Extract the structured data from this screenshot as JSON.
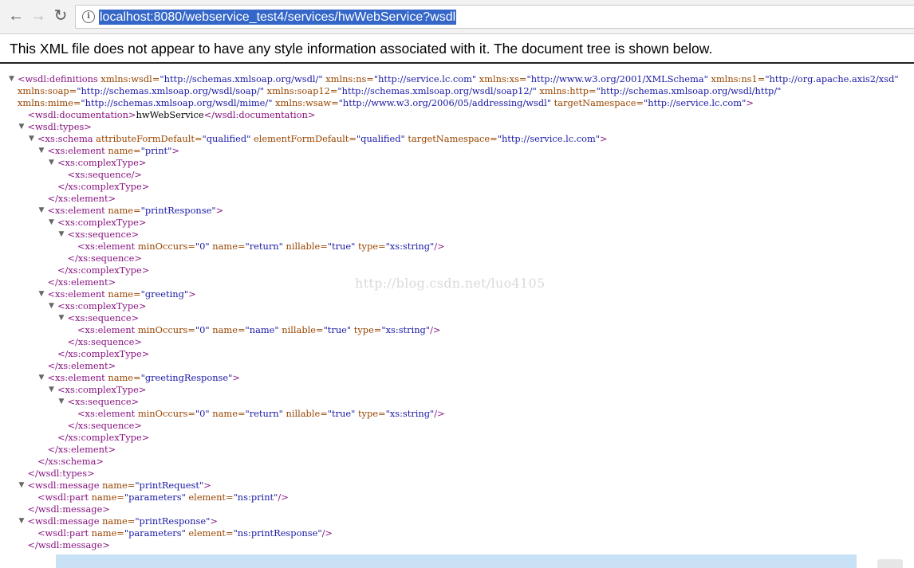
{
  "browser": {
    "back_glyph": "←",
    "forward_glyph": "→",
    "reload_glyph": "↻",
    "info_glyph": "i",
    "url": "localhost:8080/webservice_test4/services/hwWebService?wsdl"
  },
  "notice": "This XML file does not appear to have any style information associated with it. The document tree is shown below.",
  "watermark": "http://blog.csdn.net/luo4105",
  "tree": {
    "expander_glyph": "▼",
    "lines": [
      {
        "indent": 0,
        "toggle": true,
        "parts": [
          {
            "t": "tag",
            "v": "<wsdl:definitions "
          },
          {
            "t": "an",
            "v": "xmlns:wsdl="
          },
          {
            "t": "av",
            "v": "\"http://schemas.xmlsoap.org/wsdl/\""
          },
          {
            "t": "an",
            "v": " xmlns:ns="
          },
          {
            "t": "av",
            "v": "\"http://service.lc.com\""
          },
          {
            "t": "an",
            "v": " xmlns:xs="
          },
          {
            "t": "av",
            "v": "\"http://www.w3.org/2001/XMLSchema\""
          },
          {
            "t": "an",
            "v": " xmlns:ns1="
          },
          {
            "t": "av",
            "v": "\"http://org.apache.axis2/xsd\""
          }
        ]
      },
      {
        "indent": 0,
        "toggle": false,
        "parts": [
          {
            "t": "an",
            "v": "xmlns:soap="
          },
          {
            "t": "av",
            "v": "\"http://schemas.xmlsoap.org/wsdl/soap/\""
          },
          {
            "t": "an",
            "v": " xmlns:soap12="
          },
          {
            "t": "av",
            "v": "\"http://schemas.xmlsoap.org/wsdl/soap12/\""
          },
          {
            "t": "an",
            "v": " xmlns:http="
          },
          {
            "t": "av",
            "v": "\"http://schemas.xmlsoap.org/wsdl/http/\""
          }
        ]
      },
      {
        "indent": 0,
        "toggle": false,
        "parts": [
          {
            "t": "an",
            "v": "xmlns:mime="
          },
          {
            "t": "av",
            "v": "\"http://schemas.xmlsoap.org/wsdl/mime/\""
          },
          {
            "t": "an",
            "v": " xmlns:wsaw="
          },
          {
            "t": "av",
            "v": "\"http://www.w3.org/2006/05/addressing/wsdl\""
          },
          {
            "t": "an",
            "v": " targetNamespace="
          },
          {
            "t": "av",
            "v": "\"http://service.lc.com\""
          },
          {
            "t": "tag",
            "v": ">"
          }
        ]
      },
      {
        "indent": 1,
        "toggle": false,
        "parts": [
          {
            "t": "tag",
            "v": "<wsdl:documentation>"
          },
          {
            "t": "tx",
            "v": "hwWebService"
          },
          {
            "t": "tag",
            "v": "</wsdl:documentation>"
          }
        ]
      },
      {
        "indent": 1,
        "toggle": true,
        "parts": [
          {
            "t": "tag",
            "v": "<wsdl:types>"
          }
        ]
      },
      {
        "indent": 2,
        "toggle": true,
        "parts": [
          {
            "t": "tag",
            "v": "<xs:schema "
          },
          {
            "t": "an",
            "v": "attributeFormDefault="
          },
          {
            "t": "av",
            "v": "\"qualified\""
          },
          {
            "t": "an",
            "v": " elementFormDefault="
          },
          {
            "t": "av",
            "v": "\"qualified\""
          },
          {
            "t": "an",
            "v": " targetNamespace="
          },
          {
            "t": "av",
            "v": "\"http://service.lc.com\""
          },
          {
            "t": "tag",
            "v": ">"
          }
        ]
      },
      {
        "indent": 3,
        "toggle": true,
        "parts": [
          {
            "t": "tag",
            "v": "<xs:element "
          },
          {
            "t": "an",
            "v": "name="
          },
          {
            "t": "av",
            "v": "\"print\""
          },
          {
            "t": "tag",
            "v": ">"
          }
        ]
      },
      {
        "indent": 4,
        "toggle": true,
        "parts": [
          {
            "t": "tag",
            "v": "<xs:complexType>"
          }
        ]
      },
      {
        "indent": 5,
        "toggle": false,
        "parts": [
          {
            "t": "tag",
            "v": "<xs:sequence/>"
          }
        ]
      },
      {
        "indent": 4,
        "toggle": false,
        "parts": [
          {
            "t": "tag",
            "v": "</xs:complexType>"
          }
        ]
      },
      {
        "indent": 3,
        "toggle": false,
        "parts": [
          {
            "t": "tag",
            "v": "</xs:element>"
          }
        ]
      },
      {
        "indent": 3,
        "toggle": true,
        "parts": [
          {
            "t": "tag",
            "v": "<xs:element "
          },
          {
            "t": "an",
            "v": "name="
          },
          {
            "t": "av",
            "v": "\"printResponse\""
          },
          {
            "t": "tag",
            "v": ">"
          }
        ]
      },
      {
        "indent": 4,
        "toggle": true,
        "parts": [
          {
            "t": "tag",
            "v": "<xs:complexType>"
          }
        ]
      },
      {
        "indent": 5,
        "toggle": true,
        "parts": [
          {
            "t": "tag",
            "v": "<xs:sequence>"
          }
        ]
      },
      {
        "indent": 6,
        "toggle": false,
        "parts": [
          {
            "t": "tag",
            "v": "<xs:element "
          },
          {
            "t": "an",
            "v": "minOccurs="
          },
          {
            "t": "av",
            "v": "\"0\""
          },
          {
            "t": "an",
            "v": " name="
          },
          {
            "t": "av",
            "v": "\"return\""
          },
          {
            "t": "an",
            "v": " nillable="
          },
          {
            "t": "av",
            "v": "\"true\""
          },
          {
            "t": "an",
            "v": " type="
          },
          {
            "t": "av",
            "v": "\"xs:string\""
          },
          {
            "t": "tag",
            "v": "/>"
          }
        ]
      },
      {
        "indent": 5,
        "toggle": false,
        "parts": [
          {
            "t": "tag",
            "v": "</xs:sequence>"
          }
        ]
      },
      {
        "indent": 4,
        "toggle": false,
        "parts": [
          {
            "t": "tag",
            "v": "</xs:complexType>"
          }
        ]
      },
      {
        "indent": 3,
        "toggle": false,
        "parts": [
          {
            "t": "tag",
            "v": "</xs:element>"
          }
        ]
      },
      {
        "indent": 3,
        "toggle": true,
        "parts": [
          {
            "t": "tag",
            "v": "<xs:element "
          },
          {
            "t": "an",
            "v": "name="
          },
          {
            "t": "av",
            "v": "\"greeting\""
          },
          {
            "t": "tag",
            "v": ">"
          }
        ]
      },
      {
        "indent": 4,
        "toggle": true,
        "parts": [
          {
            "t": "tag",
            "v": "<xs:complexType>"
          }
        ]
      },
      {
        "indent": 5,
        "toggle": true,
        "parts": [
          {
            "t": "tag",
            "v": "<xs:sequence>"
          }
        ]
      },
      {
        "indent": 6,
        "toggle": false,
        "parts": [
          {
            "t": "tag",
            "v": "<xs:element "
          },
          {
            "t": "an",
            "v": "minOccurs="
          },
          {
            "t": "av",
            "v": "\"0\""
          },
          {
            "t": "an",
            "v": " name="
          },
          {
            "t": "av",
            "v": "\"name\""
          },
          {
            "t": "an",
            "v": " nillable="
          },
          {
            "t": "av",
            "v": "\"true\""
          },
          {
            "t": "an",
            "v": " type="
          },
          {
            "t": "av",
            "v": "\"xs:string\""
          },
          {
            "t": "tag",
            "v": "/>"
          }
        ]
      },
      {
        "indent": 5,
        "toggle": false,
        "parts": [
          {
            "t": "tag",
            "v": "</xs:sequence>"
          }
        ]
      },
      {
        "indent": 4,
        "toggle": false,
        "parts": [
          {
            "t": "tag",
            "v": "</xs:complexType>"
          }
        ]
      },
      {
        "indent": 3,
        "toggle": false,
        "parts": [
          {
            "t": "tag",
            "v": "</xs:element>"
          }
        ]
      },
      {
        "indent": 3,
        "toggle": true,
        "parts": [
          {
            "t": "tag",
            "v": "<xs:element "
          },
          {
            "t": "an",
            "v": "name="
          },
          {
            "t": "av",
            "v": "\"greetingResponse\""
          },
          {
            "t": "tag",
            "v": ">"
          }
        ]
      },
      {
        "indent": 4,
        "toggle": true,
        "parts": [
          {
            "t": "tag",
            "v": "<xs:complexType>"
          }
        ]
      },
      {
        "indent": 5,
        "toggle": true,
        "parts": [
          {
            "t": "tag",
            "v": "<xs:sequence>"
          }
        ]
      },
      {
        "indent": 6,
        "toggle": false,
        "parts": [
          {
            "t": "tag",
            "v": "<xs:element "
          },
          {
            "t": "an",
            "v": "minOccurs="
          },
          {
            "t": "av",
            "v": "\"0\""
          },
          {
            "t": "an",
            "v": " name="
          },
          {
            "t": "av",
            "v": "\"return\""
          },
          {
            "t": "an",
            "v": " nillable="
          },
          {
            "t": "av",
            "v": "\"true\""
          },
          {
            "t": "an",
            "v": " type="
          },
          {
            "t": "av",
            "v": "\"xs:string\""
          },
          {
            "t": "tag",
            "v": "/>"
          }
        ]
      },
      {
        "indent": 5,
        "toggle": false,
        "parts": [
          {
            "t": "tag",
            "v": "</xs:sequence>"
          }
        ]
      },
      {
        "indent": 4,
        "toggle": false,
        "parts": [
          {
            "t": "tag",
            "v": "</xs:complexType>"
          }
        ]
      },
      {
        "indent": 3,
        "toggle": false,
        "parts": [
          {
            "t": "tag",
            "v": "</xs:element>"
          }
        ]
      },
      {
        "indent": 2,
        "toggle": false,
        "parts": [
          {
            "t": "tag",
            "v": "</xs:schema>"
          }
        ]
      },
      {
        "indent": 1,
        "toggle": false,
        "parts": [
          {
            "t": "tag",
            "v": "</wsdl:types>"
          }
        ]
      },
      {
        "indent": 1,
        "toggle": true,
        "parts": [
          {
            "t": "tag",
            "v": "<wsdl:message "
          },
          {
            "t": "an",
            "v": "name="
          },
          {
            "t": "av",
            "v": "\"printRequest\""
          },
          {
            "t": "tag",
            "v": ">"
          }
        ]
      },
      {
        "indent": 2,
        "toggle": false,
        "parts": [
          {
            "t": "tag",
            "v": "<wsdl:part "
          },
          {
            "t": "an",
            "v": "name="
          },
          {
            "t": "av",
            "v": "\"parameters\""
          },
          {
            "t": "an",
            "v": " element="
          },
          {
            "t": "av",
            "v": "\"ns:print\""
          },
          {
            "t": "tag",
            "v": "/>"
          }
        ]
      },
      {
        "indent": 1,
        "toggle": false,
        "parts": [
          {
            "t": "tag",
            "v": "</wsdl:message>"
          }
        ]
      },
      {
        "indent": 1,
        "toggle": true,
        "parts": [
          {
            "t": "tag",
            "v": "<wsdl:message "
          },
          {
            "t": "an",
            "v": "name="
          },
          {
            "t": "av",
            "v": "\"printResponse\""
          },
          {
            "t": "tag",
            "v": ">"
          }
        ]
      },
      {
        "indent": 2,
        "toggle": false,
        "parts": [
          {
            "t": "tag",
            "v": "<wsdl:part "
          },
          {
            "t": "an",
            "v": "name="
          },
          {
            "t": "av",
            "v": "\"parameters\""
          },
          {
            "t": "an",
            "v": " element="
          },
          {
            "t": "av",
            "v": "\"ns:printResponse\""
          },
          {
            "t": "tag",
            "v": "/>"
          }
        ]
      },
      {
        "indent": 1,
        "toggle": false,
        "parts": [
          {
            "t": "tag",
            "v": "</wsdl:message>"
          }
        ]
      }
    ]
  }
}
